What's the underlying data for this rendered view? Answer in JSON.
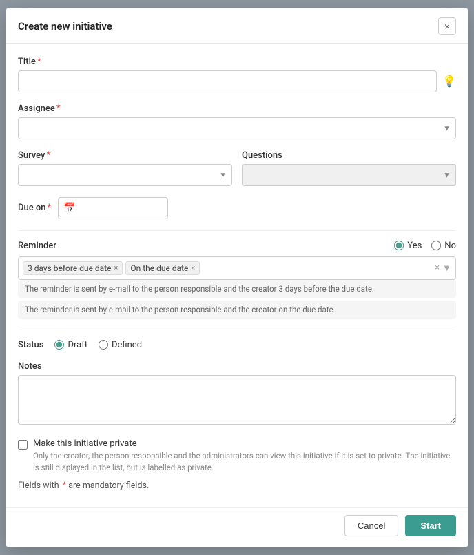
{
  "modal": {
    "title": "Create new initiative",
    "close_label": "×"
  },
  "form": {
    "title_label": "Title",
    "title_placeholder": "",
    "assignee_label": "Assignee",
    "survey_label": "Survey",
    "questions_label": "Questions",
    "due_on_label": "Due on",
    "reminder_label": "Reminder",
    "reminder_yes": "Yes",
    "reminder_no": "No",
    "tag1": "3 days before due date",
    "tag2": "On the due date",
    "reminder_info1": "The reminder is sent by e-mail to the person responsible and the creator 3 days before the due date.",
    "reminder_info2": "The reminder is sent by e-mail to the person responsible and the creator on the due date.",
    "status_label": "Status",
    "status_draft": "Draft",
    "status_defined": "Defined",
    "notes_label": "Notes",
    "private_label": "Make this initiative private",
    "private_desc": "Only the creator, the person responsible and the administrators can view this initiative if it is set to private. The initiative is still displayed in the list, but is labelled as private.",
    "mandatory_note": "Fields with",
    "mandatory_star": "*",
    "mandatory_suffix": "are mandatory fields.",
    "cancel_label": "Cancel",
    "start_label": "Start"
  }
}
